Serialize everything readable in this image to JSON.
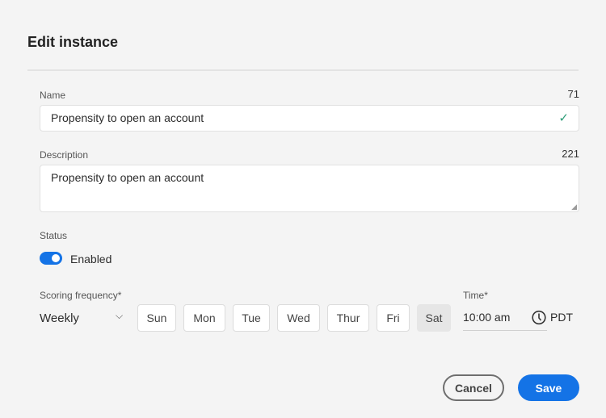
{
  "dialog": {
    "title": "Edit instance"
  },
  "name": {
    "label": "Name",
    "count": "71",
    "value": "Propensity to open an account"
  },
  "description": {
    "label": "Description",
    "count": "221",
    "value": "Propensity to open an account"
  },
  "status": {
    "label": "Status",
    "toggle_label": "Enabled",
    "enabled": true
  },
  "scoring": {
    "label": "Scoring frequency*",
    "value": "Weekly",
    "days": [
      "Sun",
      "Mon",
      "Tue",
      "Wed",
      "Thur",
      "Fri",
      "Sat"
    ],
    "selected_day": "Sat"
  },
  "time": {
    "label": "Time*",
    "value": "10:00 am",
    "timezone": "PDT"
  },
  "footer": {
    "cancel": "Cancel",
    "save": "Save"
  },
  "colors": {
    "accent": "#1473e6",
    "check": "#2d9d78"
  }
}
